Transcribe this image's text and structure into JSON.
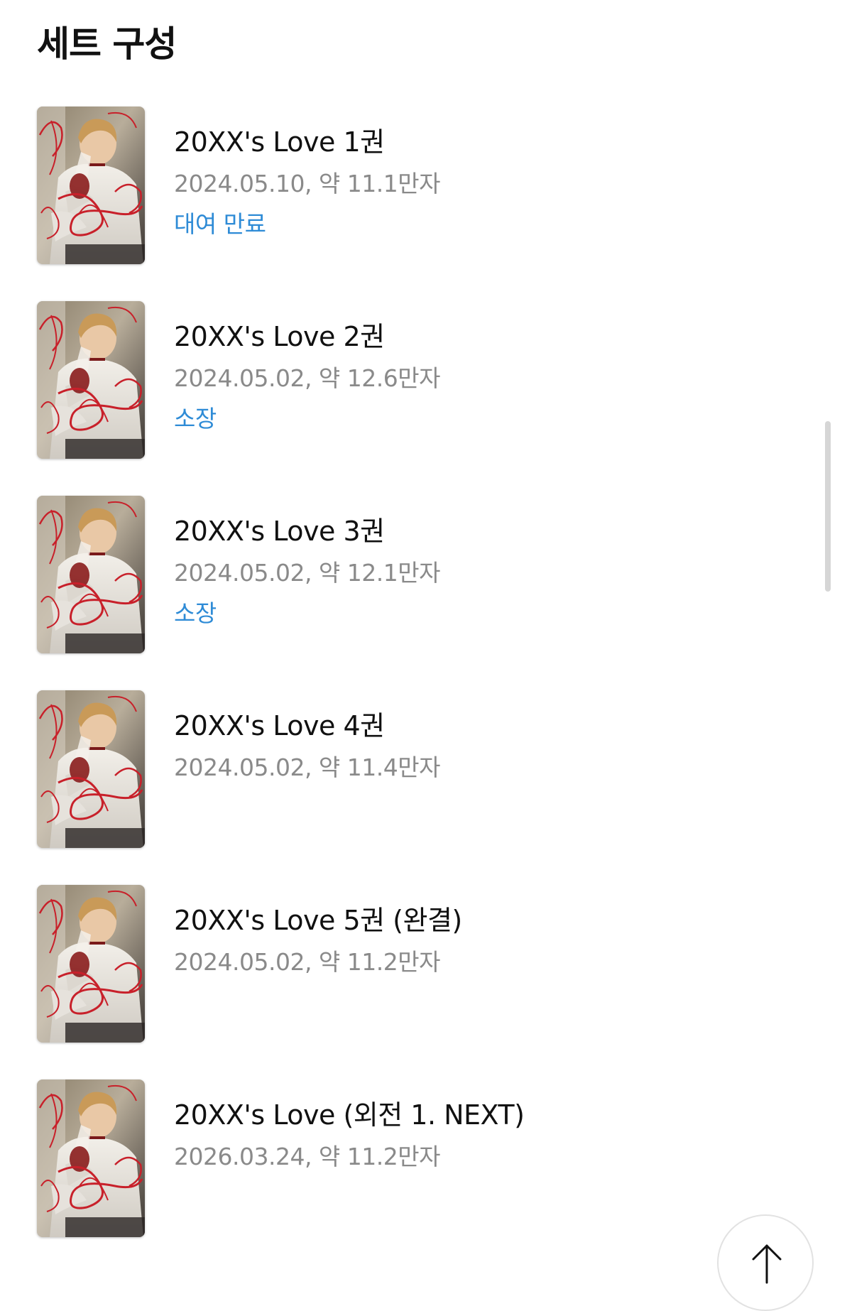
{
  "section": {
    "title": "세트 구성"
  },
  "volumes": [
    {
      "title": "20XX's Love 1권",
      "meta": "2024.05.10, 약 11.1만자",
      "status": "대여 만료"
    },
    {
      "title": "20XX's Love 2권",
      "meta": "2024.05.02, 약 12.6만자",
      "status": "소장"
    },
    {
      "title": "20XX's Love 3권",
      "meta": "2024.05.02, 약 12.1만자",
      "status": "소장"
    },
    {
      "title": "20XX's Love 4권",
      "meta": "2024.05.02, 약 11.4만자",
      "status": ""
    },
    {
      "title": "20XX's Love 5권 (완결)",
      "meta": "2024.05.02, 약 11.2만자",
      "status": ""
    },
    {
      "title": "20XX's Love (외전 1. NEXT)",
      "meta": "2026.03.24, 약 11.2만자",
      "status": ""
    }
  ],
  "colors": {
    "status_blue": "#2e8bd6",
    "meta_gray": "#8a8a8a",
    "cover_red": "#c8202a"
  },
  "icons": {
    "scroll_top": "arrow-up-icon",
    "cover": "book-cover-image"
  }
}
